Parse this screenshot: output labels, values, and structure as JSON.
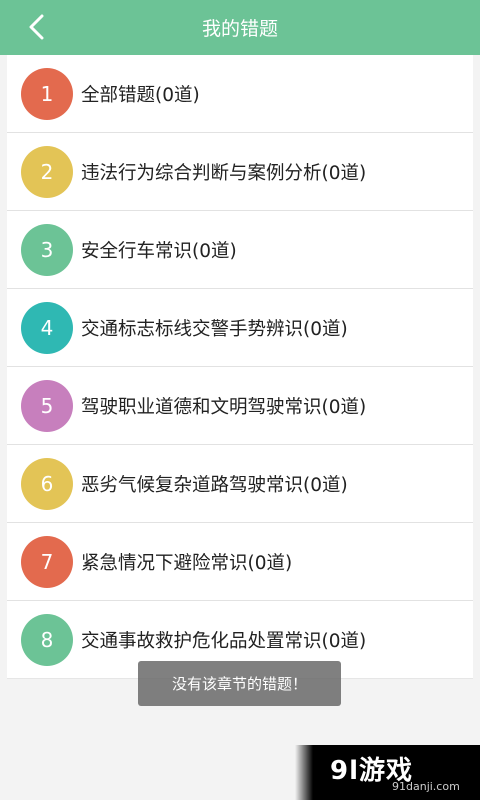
{
  "header": {
    "title": "我的错题",
    "back_icon": "chevron-left-icon"
  },
  "list": {
    "items": [
      {
        "num": "1",
        "label": "全部错题(0道)",
        "color": "#e36a4e"
      },
      {
        "num": "2",
        "label": "违法行为综合判断与案例分析(0道)",
        "color": "#e3c456"
      },
      {
        "num": "3",
        "label": "安全行车常识(0道)",
        "color": "#6cc396"
      },
      {
        "num": "4",
        "label": "交通标志标线交警手势辨识(0道)",
        "color": "#2fb8b3"
      },
      {
        "num": "5",
        "label": "驾驶职业道德和文明驾驶常识(0道)",
        "color": "#c77fbd"
      },
      {
        "num": "6",
        "label": "恶劣气候复杂道路驾驶常识(0道)",
        "color": "#e3c456"
      },
      {
        "num": "7",
        "label": "紧急情况下避险常识(0道)",
        "color": "#e36a4e"
      },
      {
        "num": "8",
        "label": "交通事故救护危化品处置常识(0道)",
        "color": "#6cc396"
      }
    ]
  },
  "toast": {
    "text": "没有该章节的错题！"
  },
  "watermark": {
    "logo": "9l游戏",
    "url": "91danji.com"
  },
  "colors": {
    "header_bg": "#6cc396",
    "page_bg": "#f3f3f3"
  }
}
